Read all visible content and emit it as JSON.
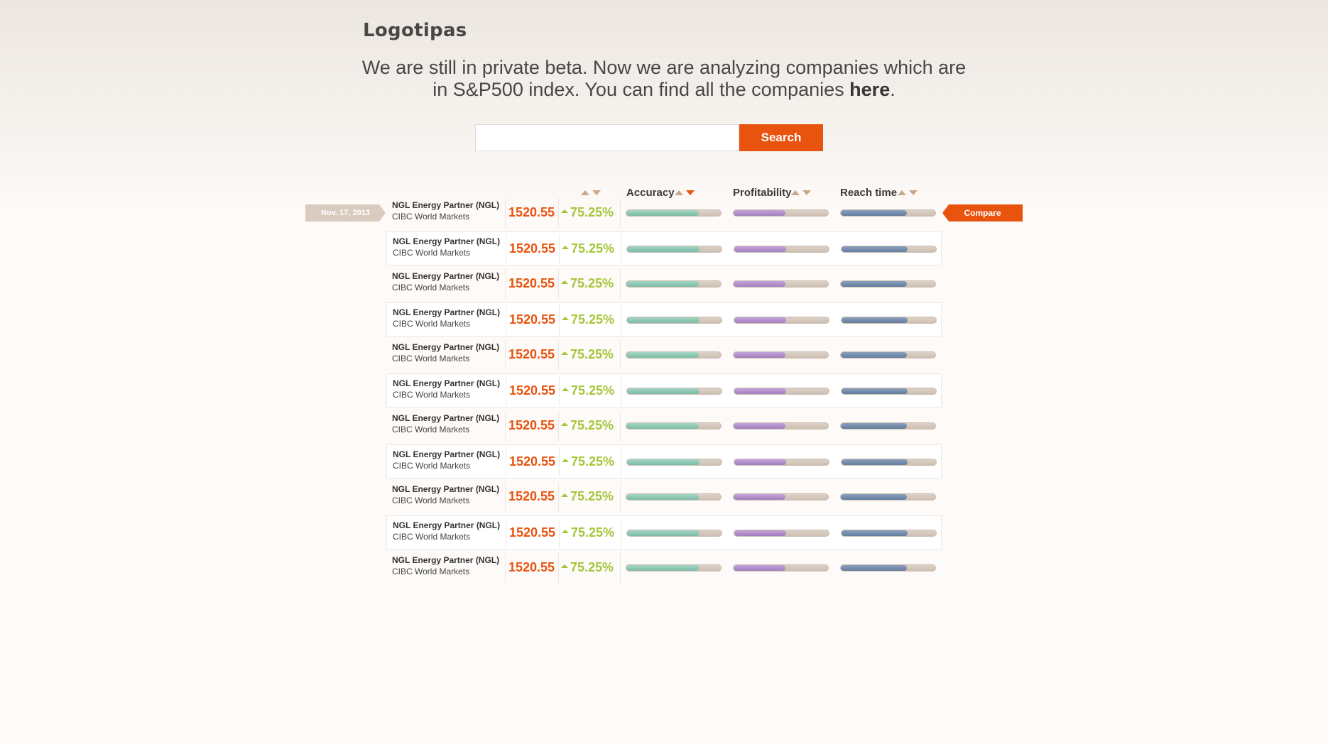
{
  "brand": {
    "logo": "Logotipas"
  },
  "intro": {
    "text_before": "We are still in private beta. Now we are analyzing companies which are in S&P500 index. You can find all the companies ",
    "link": "here",
    "text_after": "."
  },
  "search": {
    "value": "",
    "placeholder": "",
    "button_label": "Search"
  },
  "table": {
    "headers": {
      "accuracy": "Accuracy",
      "profitability": "Profitability",
      "reach_time": "Reach time"
    },
    "date_tag": "Nov. 17, 2013",
    "compare_label": "Compare",
    "rows": [
      {
        "company": "NGL Energy Partner (NGL)",
        "broker": "CIBC World Markets",
        "price": "1520.55",
        "change": "75.25%",
        "accuracy": 0.77,
        "profitability": 0.55,
        "reach_time": 0.7
      },
      {
        "company": "NGL Energy Partner (NGL)",
        "broker": "CIBC World Markets",
        "price": "1520.55",
        "change": "75.25%",
        "accuracy": 0.77,
        "profitability": 0.55,
        "reach_time": 0.7
      },
      {
        "company": "NGL Energy Partner (NGL)",
        "broker": "CIBC World Markets",
        "price": "1520.55",
        "change": "75.25%",
        "accuracy": 0.77,
        "profitability": 0.55,
        "reach_time": 0.7
      },
      {
        "company": "NGL Energy Partner (NGL)",
        "broker": "CIBC World Markets",
        "price": "1520.55",
        "change": "75.25%",
        "accuracy": 0.77,
        "profitability": 0.55,
        "reach_time": 0.7
      },
      {
        "company": "NGL Energy Partner (NGL)",
        "broker": "CIBC World Markets",
        "price": "1520.55",
        "change": "75.25%",
        "accuracy": 0.77,
        "profitability": 0.55,
        "reach_time": 0.7
      },
      {
        "company": "NGL Energy Partner (NGL)",
        "broker": "CIBC World Markets",
        "price": "1520.55",
        "change": "75.25%",
        "accuracy": 0.77,
        "profitability": 0.55,
        "reach_time": 0.7
      },
      {
        "company": "NGL Energy Partner (NGL)",
        "broker": "CIBC World Markets",
        "price": "1520.55",
        "change": "75.25%",
        "accuracy": 0.77,
        "profitability": 0.55,
        "reach_time": 0.7
      },
      {
        "company": "NGL Energy Partner (NGL)",
        "broker": "CIBC World Markets",
        "price": "1520.55",
        "change": "75.25%",
        "accuracy": 0.77,
        "profitability": 0.55,
        "reach_time": 0.7
      },
      {
        "company": "NGL Energy Partner (NGL)",
        "broker": "CIBC World Markets",
        "price": "1520.55",
        "change": "75.25%",
        "accuracy": 0.77,
        "profitability": 0.55,
        "reach_time": 0.7
      },
      {
        "company": "NGL Energy Partner (NGL)",
        "broker": "CIBC World Markets",
        "price": "1520.55",
        "change": "75.25%",
        "accuracy": 0.77,
        "profitability": 0.55,
        "reach_time": 0.7
      },
      {
        "company": "NGL Energy Partner (NGL)",
        "broker": "CIBC World Markets",
        "price": "1520.55",
        "change": "75.25%",
        "accuracy": 0.77,
        "profitability": 0.55,
        "reach_time": 0.7
      }
    ]
  },
  "colors": {
    "accent": "#e8530e",
    "positive": "#a5c63a",
    "accuracy_bar": "#7cbba6",
    "profitability_bar": "#a27fbf",
    "reach_time_bar": "#647d9e"
  }
}
